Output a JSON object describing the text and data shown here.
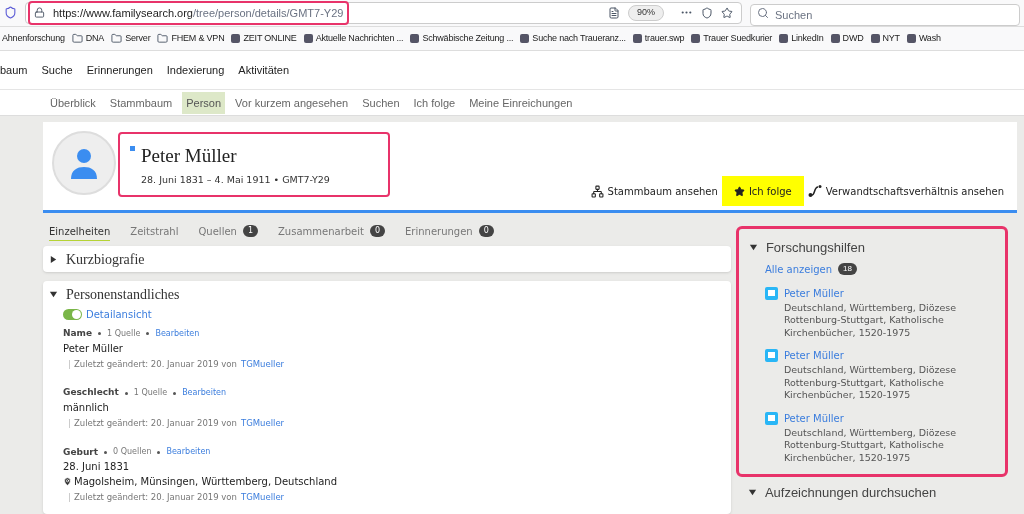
{
  "browser": {
    "url_host": "https://www.familysearch.org",
    "url_path": "/tree/person/details/GMT7-Y29",
    "zoom": "90%",
    "search_placeholder": "Suchen"
  },
  "bookmarks": [
    {
      "label": "Ahnenforschung",
      "kind": "plain"
    },
    {
      "label": "DNA",
      "kind": "folder"
    },
    {
      "label": "Server",
      "kind": "folder"
    },
    {
      "label": "FHEM & VPN",
      "kind": "folder"
    },
    {
      "label": "ZEIT ONLINE",
      "kind": "site"
    },
    {
      "label": "Aktuelle Nachrichten ...",
      "kind": "site"
    },
    {
      "label": "Schwäbische Zeitung ...",
      "kind": "site"
    },
    {
      "label": "Suche nach Traueranz...",
      "kind": "site"
    },
    {
      "label": "trauer.swp",
      "kind": "site"
    },
    {
      "label": "Trauer Suedkurier",
      "kind": "site"
    },
    {
      "label": "LinkedIn",
      "kind": "site"
    },
    {
      "label": "DWD",
      "kind": "site"
    },
    {
      "label": "NYT",
      "kind": "site"
    },
    {
      "label": "Wash",
      "kind": "site"
    }
  ],
  "main_nav": [
    "baum",
    "Suche",
    "Erinnerungen",
    "Indexierung",
    "Aktivitäten"
  ],
  "sub_nav": [
    {
      "label": "Überblick",
      "selected": false
    },
    {
      "label": "Stammbaum",
      "selected": false
    },
    {
      "label": "Person",
      "selected": true
    },
    {
      "label": "Vor kurzem angesehen",
      "selected": false
    },
    {
      "label": "Suchen",
      "selected": false
    },
    {
      "label": "Ich folge",
      "selected": false
    },
    {
      "label": "Meine Einreichungen",
      "selected": false
    }
  ],
  "person": {
    "name": "Peter Müller",
    "summary": "28. Juni 1831 – 4. Mai 1911 • GMT7-Y29"
  },
  "person_actions": [
    {
      "label": "Stammbaum ansehen",
      "kind": "tree",
      "highlighted": false
    },
    {
      "label": "Ich folge",
      "kind": "star",
      "highlighted": true
    },
    {
      "label": "Verwandtschaftsverhältnis ansehen",
      "kind": "relation",
      "highlighted": false
    }
  ],
  "tabs": [
    {
      "label": "Einzelheiten",
      "selected": true
    },
    {
      "label": "Zeitstrahl",
      "selected": false
    },
    {
      "label": "Quellen",
      "count": "1",
      "selected": false
    },
    {
      "label": "Zusammenarbeit",
      "count": "0",
      "selected": false
    },
    {
      "label": "Erinnerungen",
      "count": "0",
      "selected": false
    }
  ],
  "sections": [
    {
      "title": "Kurzbiografie",
      "expanded": false
    },
    {
      "title": "Personenstandliches",
      "expanded": true
    }
  ],
  "detail_toggle": {
    "label": "Detailansicht",
    "on": true
  },
  "facts": [
    {
      "label": "Name",
      "sources": "1 Quelle",
      "edit": "Bearbeiten",
      "value": "Peter Müller",
      "changed": "Zuletzt geändert: 20. Januar 2019 von",
      "user": "TGMueller"
    },
    {
      "label": "Geschlecht",
      "sources": "1 Quelle",
      "edit": "Bearbeiten",
      "value": "männlich",
      "changed": "Zuletzt geändert: 20. Januar 2019 von",
      "user": "TGMueller"
    },
    {
      "label": "Geburt",
      "sources": "0 Quellen",
      "edit": "Bearbeiten",
      "value": "28. Juni 1831",
      "place": "Magolsheim, Münsingen, Württemberg, Deutschland",
      "changed": "Zuletzt geändert: 20. Januar 2019 von",
      "user": "TGMueller"
    }
  ],
  "research_help": {
    "title": "Forschungshilfen",
    "show_all": "Alle anzeigen",
    "count": "18",
    "items": [
      {
        "name": "Peter Müller",
        "source": "Deutschland, Württemberg, Diözese Rottenburg-Stuttgart, Katholische Kirchenbücher, 1520-1975"
      },
      {
        "name": "Peter Müller",
        "source": "Deutschland, Württemberg, Diözese Rottenburg-Stuttgart, Katholische Kirchenbücher, 1520-1975"
      },
      {
        "name": "Peter Müller",
        "source": "Deutschland, Württemberg, Diözese Rottenburg-Stuttgart, Katholische Kirchenbücher, 1520-1975"
      }
    ]
  },
  "search_records": {
    "title": "Aufzeichnungen durchsuchen",
    "expanded": true
  }
}
